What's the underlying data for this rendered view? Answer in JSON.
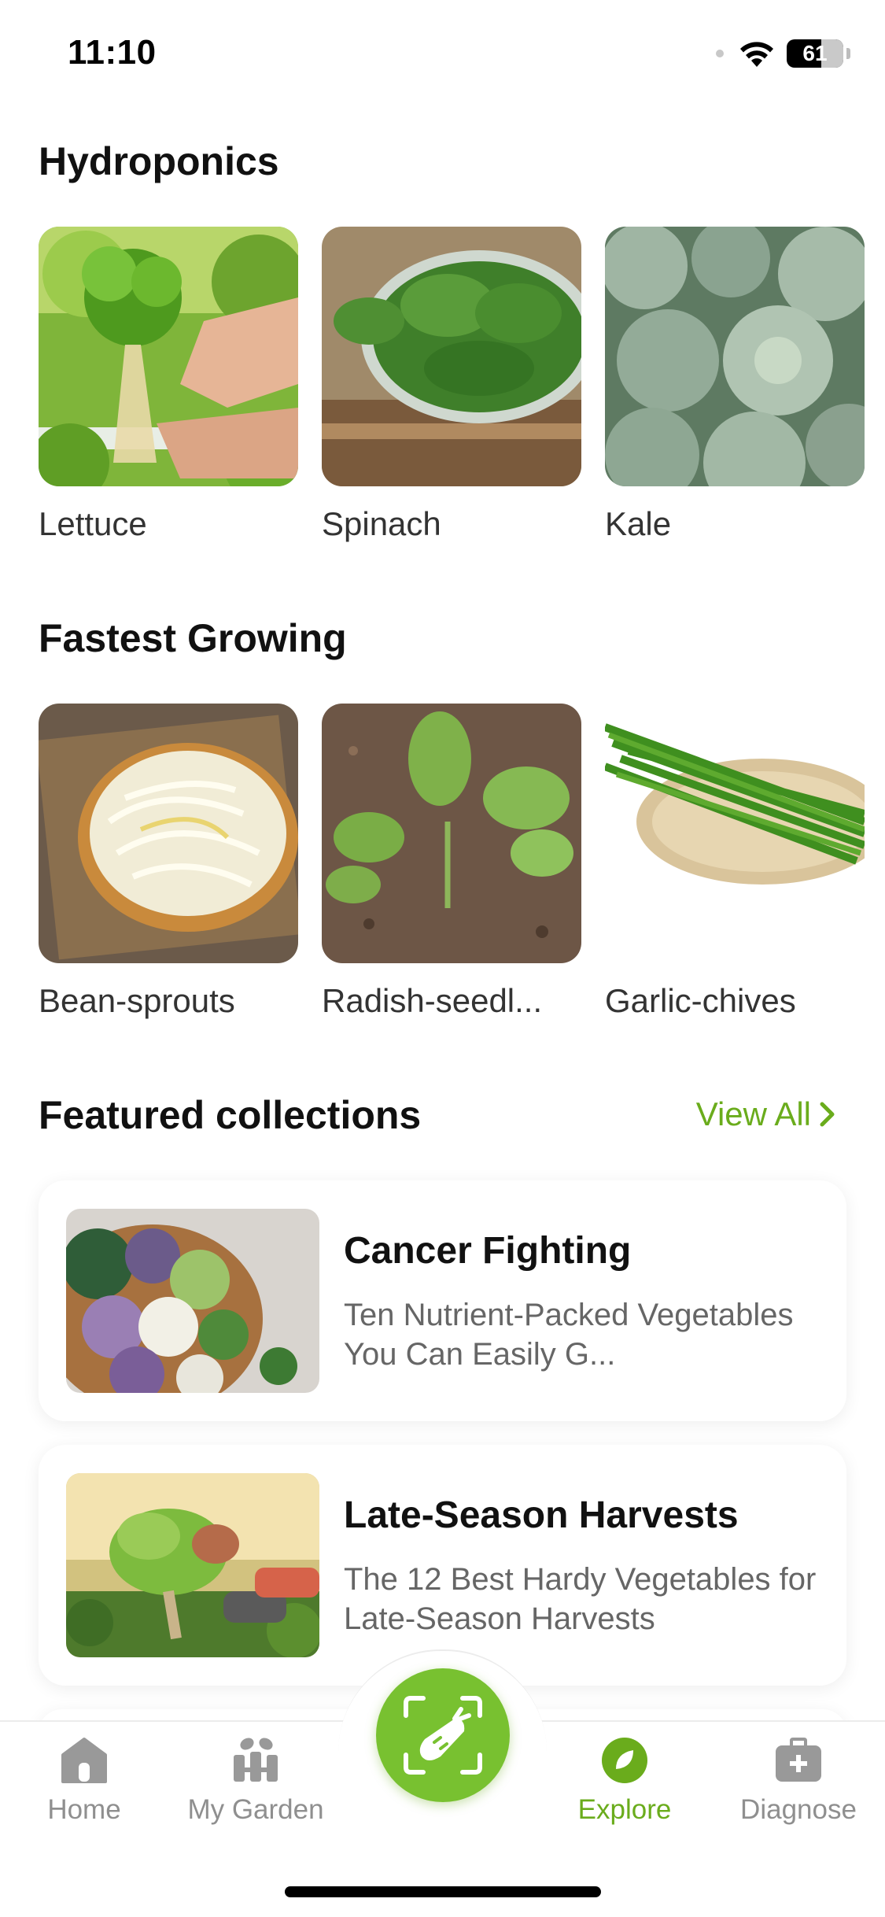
{
  "status_bar": {
    "time": "11:10",
    "battery": "61",
    "battery_level_percent": 61
  },
  "sections": {
    "hydroponics": {
      "title": "Hydroponics",
      "items": [
        {
          "label": "Lettuce",
          "image": "lettuce-photo"
        },
        {
          "label": "Spinach",
          "image": "spinach-photo"
        },
        {
          "label": "Kale",
          "image": "kale-photo"
        }
      ]
    },
    "fastest_growing": {
      "title": "Fastest Growing",
      "items": [
        {
          "label": "Bean-sprouts",
          "image": "bean-sprouts-photo"
        },
        {
          "label": "Radish-seedl...",
          "image": "radish-seedling-photo"
        },
        {
          "label": "Garlic-chives",
          "image": "garlic-chives-photo"
        }
      ]
    },
    "featured": {
      "title": "Featured collections",
      "view_all": "View All",
      "cards": [
        {
          "title": "Cancer Fighting",
          "description": "Ten Nutrient-Packed Vegetables You Can Easily G...",
          "image": "vegetable-bowl-photo"
        },
        {
          "title": "Late-Season Harvests",
          "description": "The 12 Best Hardy Vegetables for Late-Season Harvests",
          "image": "lettuce-harvest-photo"
        }
      ]
    }
  },
  "tab_bar": {
    "tabs": [
      {
        "label": "Home",
        "icon": "home-icon",
        "active": false
      },
      {
        "label": "My Garden",
        "icon": "garden-icon",
        "active": false
      },
      {
        "label": "Explore",
        "icon": "compass-leaf-icon",
        "active": true
      },
      {
        "label": "Diagnose",
        "icon": "medical-kit-icon",
        "active": false
      }
    ],
    "center_action": {
      "icon": "plant-scan-icon"
    }
  },
  "colors": {
    "accent": "#6aac1c",
    "scan_button": "#78c130",
    "inactive_tab": "#8f8f8f",
    "text_primary": "#111111",
    "text_secondary": "#666666"
  }
}
